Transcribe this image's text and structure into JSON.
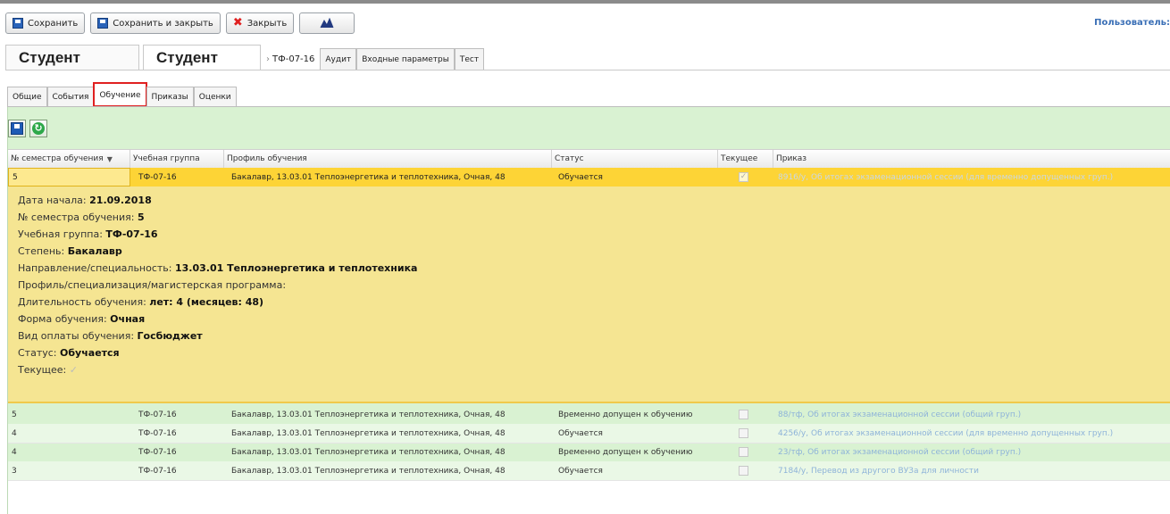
{
  "toolbar": {
    "save": "Сохранить",
    "save_close": "Сохранить и закрыть",
    "close": "Закрыть"
  },
  "user_link": "Пользователь:",
  "tabs": {
    "student1": "Студент",
    "student2": "Студент",
    "group_trail": "ТФ-07-16",
    "audit": "Аудит",
    "input_params": "Входные параметры",
    "test": "Тест"
  },
  "subtabs": [
    "Общие",
    "События",
    "Обучение",
    "Приказы",
    "Оценки"
  ],
  "grid": {
    "columns": [
      "№ семестра обучения",
      "Учебная группа",
      "Профиль обучения",
      "Статус",
      "Текущее",
      "Приказ"
    ],
    "selected_row": {
      "semester": "5",
      "group": "ТФ-07-16",
      "profile": "Бакалавр, 13.03.01 Теплоэнергетика и теплотехника, Очная, 48",
      "status": "Обучается",
      "current": "✓",
      "order": "8916/у, Об итогах экзаменационной сессии (для временно допущенных груп.)"
    },
    "rows": [
      {
        "semester": "5",
        "group": "ТФ-07-16",
        "profile": "Бакалавр, 13.03.01 Теплоэнергетика и теплотехника, Очная, 48",
        "status": "Временно допущен к обучению",
        "order": "88/тф, Об итогах экзаменационной сессии (общий груп.)"
      },
      {
        "semester": "4",
        "group": "ТФ-07-16",
        "profile": "Бакалавр, 13.03.01 Теплоэнергетика и теплотехника, Очная, 48",
        "status": "Обучается",
        "order": "4256/у, Об итогах экзаменационной сессии (для временно допущенных груп.)"
      },
      {
        "semester": "4",
        "group": "ТФ-07-16",
        "profile": "Бакалавр, 13.03.01 Теплоэнергетика и теплотехника, Очная, 48",
        "status": "Временно допущен к обучению",
        "order": "23/тф, Об итогах экзаменационной сессии (общий груп.)"
      },
      {
        "semester": "3",
        "group": "ТФ-07-16",
        "profile": "Бакалавр, 13.03.01 Теплоэнергетика и теплотехника, Очная, 48",
        "status": "Обучается",
        "order": "7184/у, Перевод из другого ВУЗа для личности"
      }
    ]
  },
  "detail": {
    "start_date_label": "Дата начала:",
    "start_date": "21.09.2018",
    "semester_label": "№ семестра обучения:",
    "semester": "5",
    "group_label": "Учебная группа:",
    "group": "ТФ-07-16",
    "degree_label": "Степень:",
    "degree": "Бакалавр",
    "direction_label": "Направление/специальность:",
    "direction": "13.03.01 Теплоэнергетика и теплотехника",
    "profile_label": "Профиль/специализация/магистерская программа:",
    "duration_label": "Длительность обучения:",
    "duration": "лет: 4 (месяцев: 48)",
    "form_label": "Форма обучения:",
    "form": "Очная",
    "payment_label": "Вид оплаты обучения:",
    "payment": "Госбюджет",
    "status_label": "Статус:",
    "status": "Обучается",
    "current_label": "Текущее:",
    "current_mark": "✓"
  }
}
